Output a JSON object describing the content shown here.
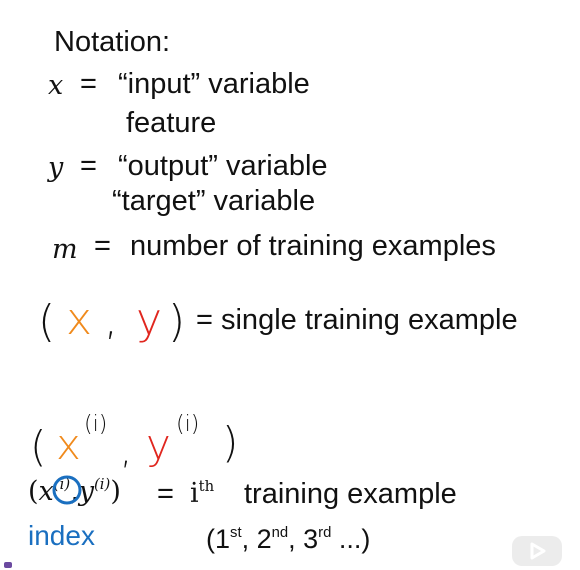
{
  "heading": "Notation:",
  "x_symbol": "x",
  "eq": "=",
  "x_desc": "“input” variable",
  "x_desc2": "feature",
  "y_symbol": "y",
  "y_desc": "“output” variable",
  "y_desc2": "“target” variable",
  "m_symbol": "m",
  "m_desc": "number of training examples",
  "pair": {
    "open": "(",
    "x": "x",
    "comma": ",",
    "y": "y",
    "close": ")",
    "desc": "= single training example"
  },
  "hand_pair": {
    "open": "(",
    "x": "x",
    "x_sup": "(i)",
    "comma": ",",
    "y": "y",
    "y_sup": "(i)",
    "close": ")"
  },
  "ith": {
    "open": "(",
    "x": "x",
    "x_sup": "(i)",
    "comma": ",",
    "y": "y",
    "y_sup": "(i)",
    "close": ")",
    "eq": "=",
    "i": "i",
    "th": "th",
    "desc": "training example"
  },
  "index_label": "index",
  "ordinals": {
    "open": "(1",
    "st": "st",
    "sep1": ", 2",
    "nd": "nd",
    "sep2": ", 3",
    "rd": "rd",
    "close": " ...)"
  },
  "colors": {
    "ink": "#111111",
    "annotation_blue": "#1a6fc0",
    "x_orange": "#f08a1c",
    "y_red": "#e0261e"
  },
  "icons": [
    "play-icon"
  ]
}
